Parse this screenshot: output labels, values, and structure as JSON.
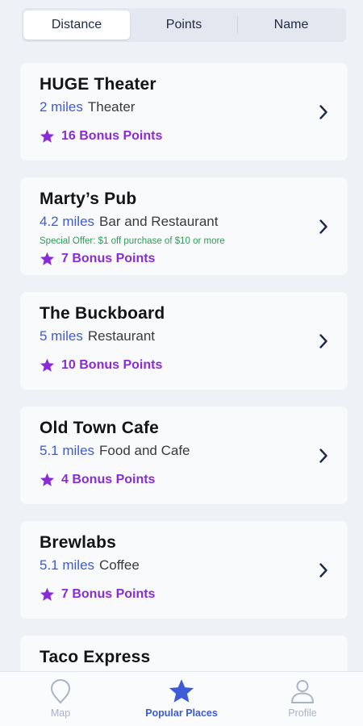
{
  "sort_tabs": [
    {
      "label": "Distance",
      "active": true
    },
    {
      "label": "Points",
      "active": false
    },
    {
      "label": "Name",
      "active": false
    }
  ],
  "places": [
    {
      "name": "HUGE Theater",
      "distance": "2 miles",
      "type": "Theater",
      "offer": "",
      "points": "16 Bonus Points"
    },
    {
      "name": "Marty’s Pub",
      "distance": "4.2 miles",
      "type": "Bar and Restaurant",
      "offer": "Special Offer: $1 off purchase of $10 or more",
      "points": "7 Bonus Points"
    },
    {
      "name": "The Buckboard",
      "distance": "5 miles",
      "type": "Restaurant",
      "offer": "",
      "points": "10 Bonus Points"
    },
    {
      "name": "Old Town Cafe",
      "distance": "5.1 miles",
      "type": "Food and Cafe",
      "offer": "",
      "points": "4 Bonus Points"
    },
    {
      "name": "Brewlabs",
      "distance": "5.1 miles",
      "type": "Coffee",
      "offer": "",
      "points": "7 Bonus Points"
    },
    {
      "name": "Taco Express",
      "distance": "",
      "type": "",
      "offer": "",
      "points": ""
    }
  ],
  "tabbar": {
    "map": {
      "label": "Map",
      "icon": "map-pin-icon"
    },
    "popular": {
      "label": "Popular Places",
      "icon": "star-icon"
    },
    "profile": {
      "label": "Profile",
      "icon": "person-icon"
    }
  },
  "colors": {
    "accent_blue": "#3d5bd6",
    "points_purple": "#8a2bd6",
    "offer_green": "#2e9b56",
    "inactive_gray": "#aab3c6"
  }
}
